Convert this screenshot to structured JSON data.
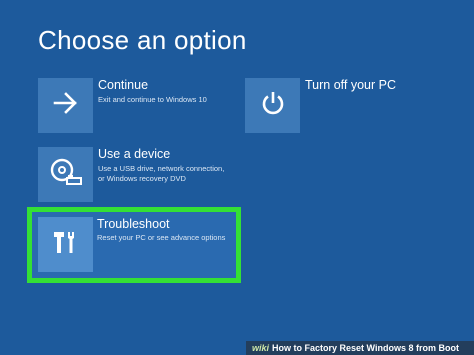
{
  "page": {
    "title": "Choose an option"
  },
  "options": {
    "continue": {
      "label": "Continue",
      "description": "Exit and continue to Windows 10",
      "icon": "arrow-right-icon"
    },
    "device": {
      "label": "Use a device",
      "description_line1": "Use a USB drive, network connection,",
      "description_line2": "or Windows recovery DVD",
      "icon": "disc-drive-icon"
    },
    "turnoff": {
      "label": "Turn off your PC",
      "icon": "power-icon"
    },
    "troubleshoot": {
      "label": "Troubleshoot",
      "description": "Reset your PC or see advance options",
      "icon": "tools-icon"
    }
  },
  "highlight": {
    "color": "#34e035"
  },
  "watermark": {
    "brand": "wiki",
    "text": "How to Factory Reset Windows 8 from Boot"
  },
  "colors": {
    "background": "#1d5a9c",
    "tile": "#3d79b7",
    "text": "#ffffff"
  }
}
